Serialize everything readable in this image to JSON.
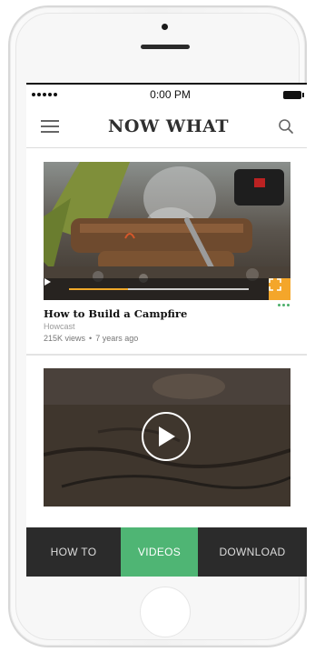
{
  "status_bar": {
    "time": "0:00 PM"
  },
  "header": {
    "title": "NOW WHAT"
  },
  "videos": [
    {
      "title": "How to Build a Campfire",
      "channel": "Howcast",
      "views": "215K views",
      "age": "7 years ago",
      "progress": 0.33
    }
  ],
  "bottom_nav": {
    "tabs": [
      {
        "label": "HOW TO",
        "active": false
      },
      {
        "label": "VIDEOS",
        "active": true
      },
      {
        "label": "DOWNLOAD",
        "active": false
      }
    ]
  },
  "colors": {
    "accent_green": "#4fb574",
    "accent_orange": "#f4a62a",
    "nav_dark": "#2b2b2b"
  },
  "icons": [
    "menu-icon",
    "search-icon",
    "play-icon",
    "fullscreen-icon",
    "more-icon",
    "battery-icon",
    "signal-icon"
  ]
}
